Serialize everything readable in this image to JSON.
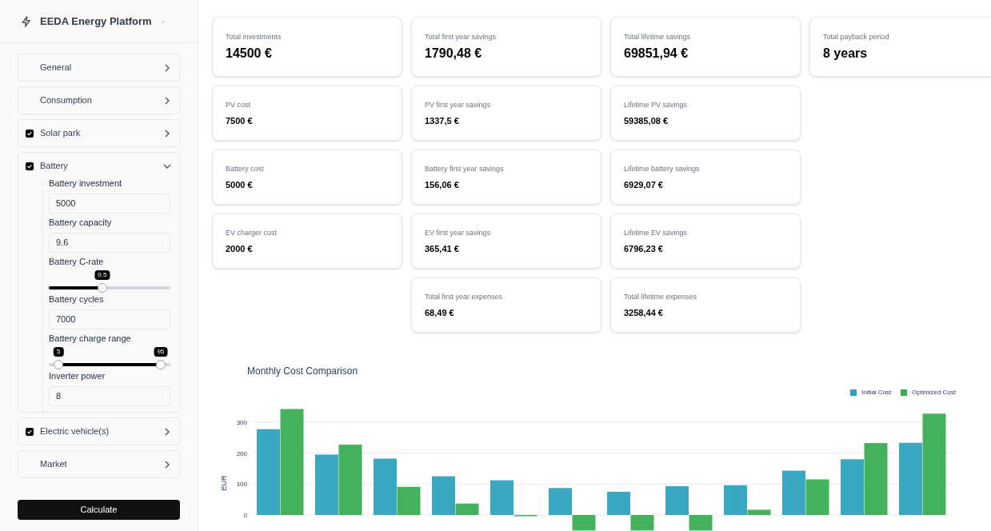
{
  "app": {
    "title": "EEDA Energy Platform"
  },
  "sidebar": {
    "sections": [
      {
        "label": "General",
        "kind": "plain",
        "expanded": false
      },
      {
        "label": "Consumption",
        "kind": "plain",
        "expanded": false
      },
      {
        "label": "Solar park",
        "kind": "checkbox",
        "checked": true,
        "expanded": false
      },
      {
        "label": "Battery",
        "kind": "checkbox",
        "checked": true,
        "expanded": true,
        "fields": [
          {
            "kind": "input",
            "label": "Battery investment",
            "value": "5000"
          },
          {
            "kind": "input",
            "label": "Battery capacity",
            "value": "9.6"
          },
          {
            "kind": "slider",
            "label": "Battery C-rate",
            "thumbs": [
              {
                "label": "0.5",
                "level": 0.44
              }
            ]
          },
          {
            "kind": "input",
            "label": "Battery cycles",
            "value": "7000"
          },
          {
            "kind": "range",
            "label": "Battery charge range",
            "thumbs": [
              {
                "label": "5",
                "level": 0.08
              },
              {
                "label": "95",
                "level": 0.92
              }
            ]
          },
          {
            "kind": "input",
            "label": "Inverter power",
            "value": "8"
          }
        ]
      },
      {
        "label": "Electric vehicle(s)",
        "kind": "checkbox",
        "checked": true,
        "expanded": false
      },
      {
        "label": "Market",
        "kind": "plain",
        "expanded": false
      }
    ],
    "button": "Calculate"
  },
  "cards": [
    {
      "label": "Total investments",
      "value": "14500 €",
      "kind": "total"
    },
    {
      "label": "Total first year savings",
      "value": "1790,48 €",
      "kind": "total"
    },
    {
      "label": "Total lifetime savings",
      "value": "69851,94 €",
      "kind": "total"
    },
    {
      "label": "Total payback period",
      "value": "8 years",
      "kind": "total"
    },
    {
      "label": "PV cost",
      "value": "7500 €",
      "kind": "detail"
    },
    {
      "label": "PV first year savings",
      "value": "1337,5 €",
      "kind": "detail"
    },
    {
      "label": "Lifetime PV savings",
      "value": "59385,08 €",
      "kind": "detail"
    },
    {
      "kind": "empty"
    },
    {
      "label": "Battery cost",
      "value": "5000 €",
      "kind": "detail"
    },
    {
      "label": "Battery first year savings",
      "value": "156,06 €",
      "kind": "detail"
    },
    {
      "label": "Lifetime battery savings",
      "value": "6929,07 €",
      "kind": "detail"
    },
    {
      "kind": "empty"
    },
    {
      "label": "EV charger cost",
      "value": "2000 €",
      "kind": "detail"
    },
    {
      "label": "EV first year savings",
      "value": "365,41 €",
      "kind": "detail"
    },
    {
      "label": "Lifetime EV savings",
      "value": "6796,23 €",
      "kind": "detail"
    },
    {
      "kind": "empty"
    },
    {
      "kind": "empty"
    },
    {
      "label": "Total first year expenses",
      "value": "68,49 €",
      "kind": "detail"
    },
    {
      "label": "Total lifetime expenses",
      "value": "3258,44 €",
      "kind": "detail"
    }
  ],
  "chart": {
    "chart_data": {
      "type": "bar",
      "title": "Monthly Cost Comparison",
      "ylabel": "EUR",
      "yticks": [
        0,
        100,
        200,
        300
      ],
      "ylim": [
        -55,
        345
      ],
      "legend": true,
      "grid": true,
      "series": [
        {
          "name": "Initial Cost",
          "color": "#2ea3bd",
          "values": [
            277,
            195,
            182,
            125,
            112,
            87,
            75,
            93,
            96,
            143,
            180,
            233
          ]
        },
        {
          "name": "Optimized Cost",
          "color": "#3aae53",
          "values": [
            342,
            227,
            91,
            37,
            -4,
            -50,
            -50,
            -50,
            17,
            115,
            232,
            327
          ]
        }
      ]
    }
  }
}
